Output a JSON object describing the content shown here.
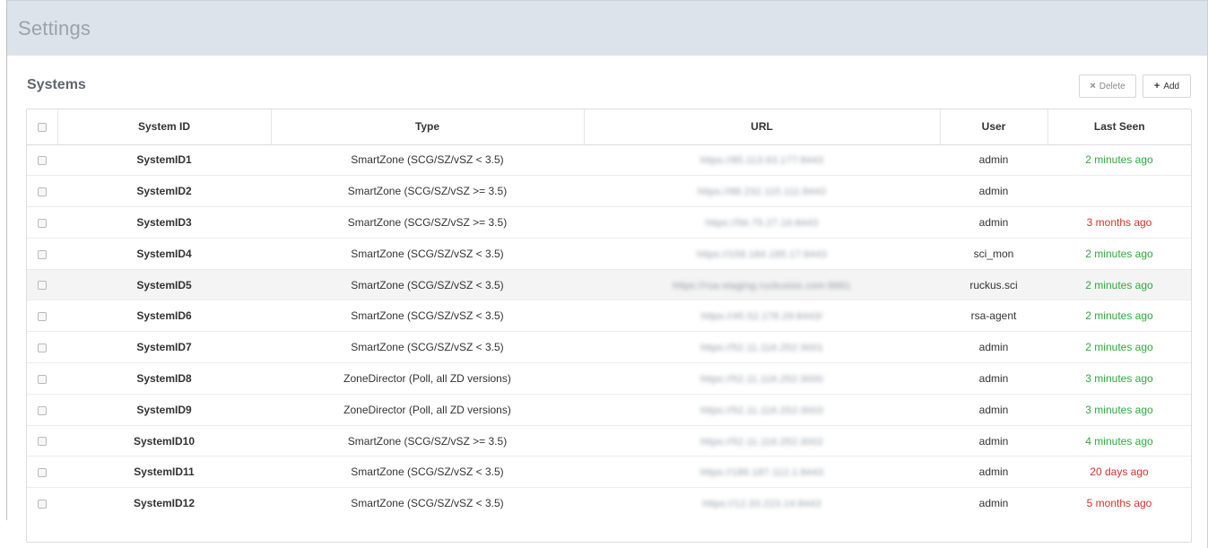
{
  "header": {
    "title": "Settings"
  },
  "panel": {
    "title": "Systems",
    "actions": {
      "delete_label": "Delete",
      "add_label": "Add"
    }
  },
  "table": {
    "columns": [
      "System ID",
      "Type",
      "URL",
      "User",
      "Last Seen"
    ],
    "rows": [
      {
        "system_id": "SystemID1",
        "type": "SmartZone (SCG/SZ/vSZ < 3.5)",
        "url": "https://85.113.63.177:8443",
        "user": "admin",
        "last_seen": "2 minutes ago",
        "status": "recent"
      },
      {
        "system_id": "SystemID2",
        "type": "SmartZone (SCG/SZ/vSZ >= 3.5)",
        "url": "https://88.232.115.111:8443",
        "user": "admin",
        "last_seen": "",
        "status": "none"
      },
      {
        "system_id": "SystemID3",
        "type": "SmartZone (SCG/SZ/vSZ >= 3.5)",
        "url": "https://56.75.27.16:8443",
        "user": "admin",
        "last_seen": "3 months ago",
        "status": "old"
      },
      {
        "system_id": "SystemID4",
        "type": "SmartZone (SCG/SZ/vSZ < 3.5)",
        "url": "https://158.184.185.17:8443",
        "user": "sci_mon",
        "last_seen": "2 minutes ago",
        "status": "recent"
      },
      {
        "system_id": "SystemID5",
        "type": "SmartZone (SCG/SZ/vSZ < 3.5)",
        "url": "https://rsa-staging.ruckusiss.com:8881",
        "user": "ruckus.sci",
        "last_seen": "2 minutes ago",
        "status": "recent"
      },
      {
        "system_id": "SystemID6",
        "type": "SmartZone (SCG/SZ/vSZ < 3.5)",
        "url": "https://45.52.178.29:8443/",
        "user": "rsa-agent",
        "last_seen": "2 minutes ago",
        "status": "recent"
      },
      {
        "system_id": "SystemID7",
        "type": "SmartZone (SCG/SZ/vSZ < 3.5)",
        "url": "https://52.11.116.252:3001",
        "user": "admin",
        "last_seen": "2 minutes ago",
        "status": "recent"
      },
      {
        "system_id": "SystemID8",
        "type": "ZoneDirector (Poll, all ZD versions)",
        "url": "https://52.11.116.252:3000",
        "user": "admin",
        "last_seen": "3 minutes ago",
        "status": "recent"
      },
      {
        "system_id": "SystemID9",
        "type": "ZoneDirector (Poll, all ZD versions)",
        "url": "https://52.11.116.252:3003",
        "user": "admin",
        "last_seen": "3 minutes ago",
        "status": "recent"
      },
      {
        "system_id": "SystemID10",
        "type": "SmartZone (SCG/SZ/vSZ >= 3.5)",
        "url": "https://52.11.116.252:3002",
        "user": "admin",
        "last_seen": "4 minutes ago",
        "status": "recent"
      },
      {
        "system_id": "SystemID11",
        "type": "SmartZone (SCG/SZ/vSZ < 3.5)",
        "url": "https://186.187.112.1:8443",
        "user": "admin",
        "last_seen": "20 days ago",
        "status": "old"
      },
      {
        "system_id": "SystemID12",
        "type": "SmartZone (SCG/SZ/vSZ < 3.5)",
        "url": "https://12.33.223.14:8443",
        "user": "admin",
        "last_seen": "5 months ago",
        "status": "old"
      }
    ]
  },
  "icons": {
    "delete": "close-icon",
    "add": "plus-icon",
    "checkbox": "checkbox-icon"
  },
  "colors": {
    "recent": "#2eaa3c",
    "old": "#d9302c",
    "header_bar": "#dde3ea"
  }
}
